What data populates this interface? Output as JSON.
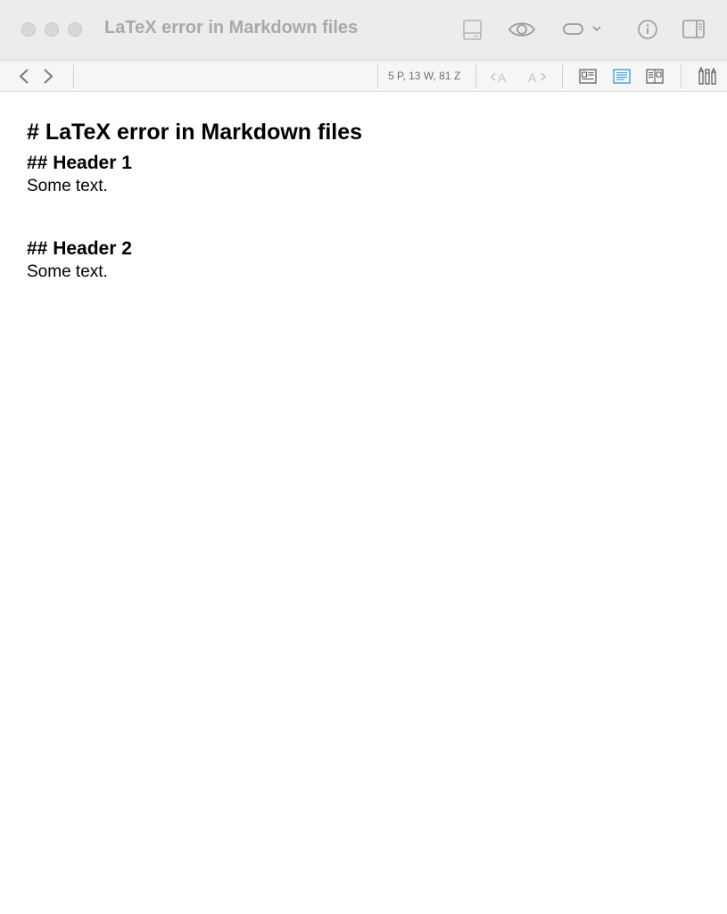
{
  "window": {
    "title": "LaTeX error in Markdown files"
  },
  "toolbar": {
    "stats": "5 P, 13 W, 81 Z",
    "icons": [
      "sidebar-bottom-icon",
      "preview-eye-icon",
      "tag-icon",
      "info-icon",
      "sidebar-right-icon"
    ],
    "active_layout": "text-layout"
  },
  "document": {
    "h1": "# LaTeX error in Markdown files",
    "sections": [
      {
        "heading": "## Header 1",
        "text": "Some text."
      },
      {
        "heading": "## Header 2",
        "text": "Some text."
      }
    ]
  },
  "colors": {
    "accent": "#2b9bd8",
    "titlebar": "#ececec"
  }
}
